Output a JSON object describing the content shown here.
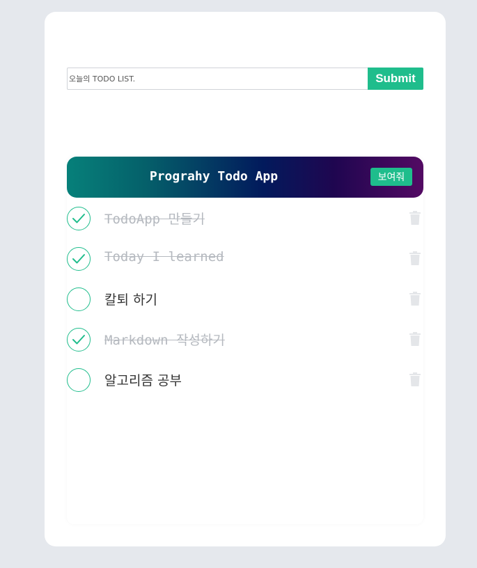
{
  "form": {
    "placeholder": "오늘의 TODO LIST.",
    "submit_label": "Submit"
  },
  "header": {
    "title": "Prograhy Todo App",
    "show_button_label": "보여줘"
  },
  "todos": [
    {
      "text": "TodoApp 만들기",
      "done": true
    },
    {
      "text": "Today I learned",
      "done": true
    },
    {
      "text": "칼퇴 하기",
      "done": false
    },
    {
      "text": "Markdown 작성하기",
      "done": true
    },
    {
      "text": "알고리즘 공부",
      "done": false
    }
  ],
  "colors": {
    "accent": "#1fbd8c",
    "background": "#e5e8ed",
    "done_text": "#b5b9bf"
  },
  "icons": {
    "check": "check-icon",
    "delete": "trash-icon"
  }
}
